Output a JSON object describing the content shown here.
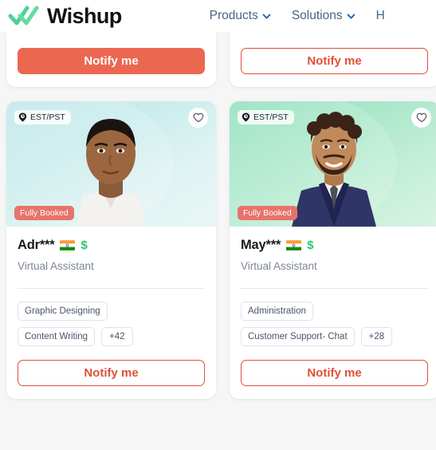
{
  "header": {
    "brand_name": "Wishup",
    "logo_icon": "double-check-logo",
    "nav": [
      {
        "label": "Products",
        "icon": "chevron-down-icon"
      },
      {
        "label": "Solutions",
        "icon": "chevron-down-icon"
      }
    ],
    "nav_truncated_label": "H"
  },
  "colors": {
    "accent_orange": "#ec6751",
    "outline_red": "#e0503a",
    "badge_red": "#e8736b",
    "brand_green": "#4ad295",
    "nav_text": "#4a6484",
    "dollar_green": "#28c76f"
  },
  "top_row": {
    "left_card": {
      "cta_label": "Notify me",
      "cta_style": "filled"
    },
    "right_card": {
      "cta_label": "Notify me",
      "cta_style": "outline"
    }
  },
  "cards": [
    {
      "timezone_badge": "EST/PST",
      "timezone_icon": "clock-pin-icon",
      "favorite_icon": "heart-icon",
      "availability_badge": "Fully Booked",
      "name": "Adr***",
      "country_flag": "india-flag",
      "rate_icon": "dollar-icon",
      "role": "Virtual Assistant",
      "skills": [
        "Graphic Designing",
        "Content Writing"
      ],
      "skills_more": "+42",
      "cta_label": "Notify me",
      "photo_bg": "teal-gradient"
    },
    {
      "timezone_badge": "EST/PST",
      "timezone_icon": "clock-pin-icon",
      "favorite_icon": "heart-icon",
      "availability_badge": "Fully Booked",
      "name": "May***",
      "country_flag": "india-flag",
      "rate_icon": "dollar-icon",
      "role": "Virtual Assistant",
      "skills": [
        "Administration",
        "Customer Support- Chat"
      ],
      "skills_more": "+28",
      "cta_label": "Notify me",
      "photo_bg": "mint-gradient"
    }
  ]
}
